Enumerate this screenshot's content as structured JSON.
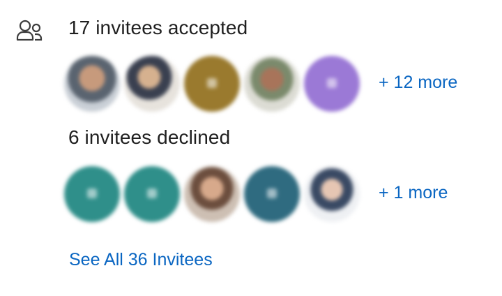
{
  "icons": {
    "people": "people-icon"
  },
  "accepted": {
    "heading": "17 invitees accepted",
    "avatars": [
      {
        "kind": "photo",
        "style": "photo-a"
      },
      {
        "kind": "photo",
        "style": "photo-b"
      },
      {
        "kind": "letter",
        "color": "#9a7a2e"
      },
      {
        "kind": "photo",
        "style": "photo-c"
      },
      {
        "kind": "letter",
        "color": "#9b79d6"
      }
    ],
    "more_label": "+ 12 more"
  },
  "declined": {
    "heading": "6 invitees declined",
    "avatars": [
      {
        "kind": "letter",
        "color": "#2f8f8a"
      },
      {
        "kind": "letter",
        "color": "#2f8f8a"
      },
      {
        "kind": "photo",
        "style": "photo-d"
      },
      {
        "kind": "letter",
        "color": "#2f6b80"
      },
      {
        "kind": "photo",
        "style": "photo-e"
      }
    ],
    "more_label": "+ 1 more"
  },
  "see_all_label": "See All 36 Invitees",
  "colors": {
    "link": "#0a66c2",
    "text": "#1f1f1f",
    "icon": "#3c3c3c"
  }
}
